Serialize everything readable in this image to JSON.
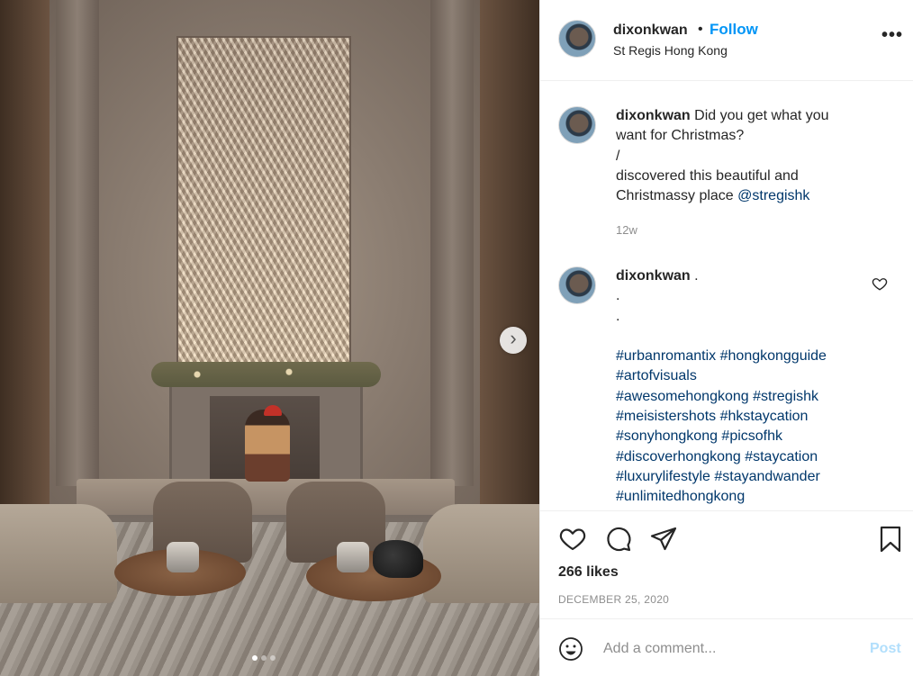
{
  "post": {
    "author": "dixonkwan",
    "separator": "•",
    "follow_label": "Follow",
    "location": "St Regis Hong Kong",
    "more_label": "•••"
  },
  "carousel": {
    "next_label": "›",
    "total_slides": 3,
    "active_slide": 1
  },
  "caption": {
    "username": "dixonkwan",
    "lines": [
      "Did you get what you",
      "want for Christmas?",
      "/",
      "discovered this beautiful and",
      "Christmassy place "
    ],
    "mention": "@stregishk",
    "time": "12w"
  },
  "comment": {
    "username": "dixonkwan",
    "first_text": " .",
    "dot_lines": [
      ".",
      "."
    ],
    "hashtag_lines": [
      "#urbanromantix #hongkongguide",
      "#artofvisuals",
      "#awesomehongkong #stregishk",
      "#meisistershots #hkstaycation",
      "#sonyhongkong #picsofhk",
      "#discoverhongkong #staycation",
      "#luxurylifestyle #stayandwander",
      "#unlimitedhongkong"
    ]
  },
  "stats": {
    "likes": "266 likes",
    "date": "DECEMBER 25, 2020"
  },
  "add_comment": {
    "placeholder": "Add a comment...",
    "post_label": "Post"
  },
  "colors": {
    "follow": "#0095f6",
    "link": "#00376b",
    "muted": "#8e8e8e",
    "post_disabled": "#b2dffc"
  },
  "icons": [
    "heart-icon",
    "comment-icon",
    "share-icon",
    "bookmark-icon",
    "emoji-icon",
    "more-icon",
    "chevron-right-icon"
  ]
}
